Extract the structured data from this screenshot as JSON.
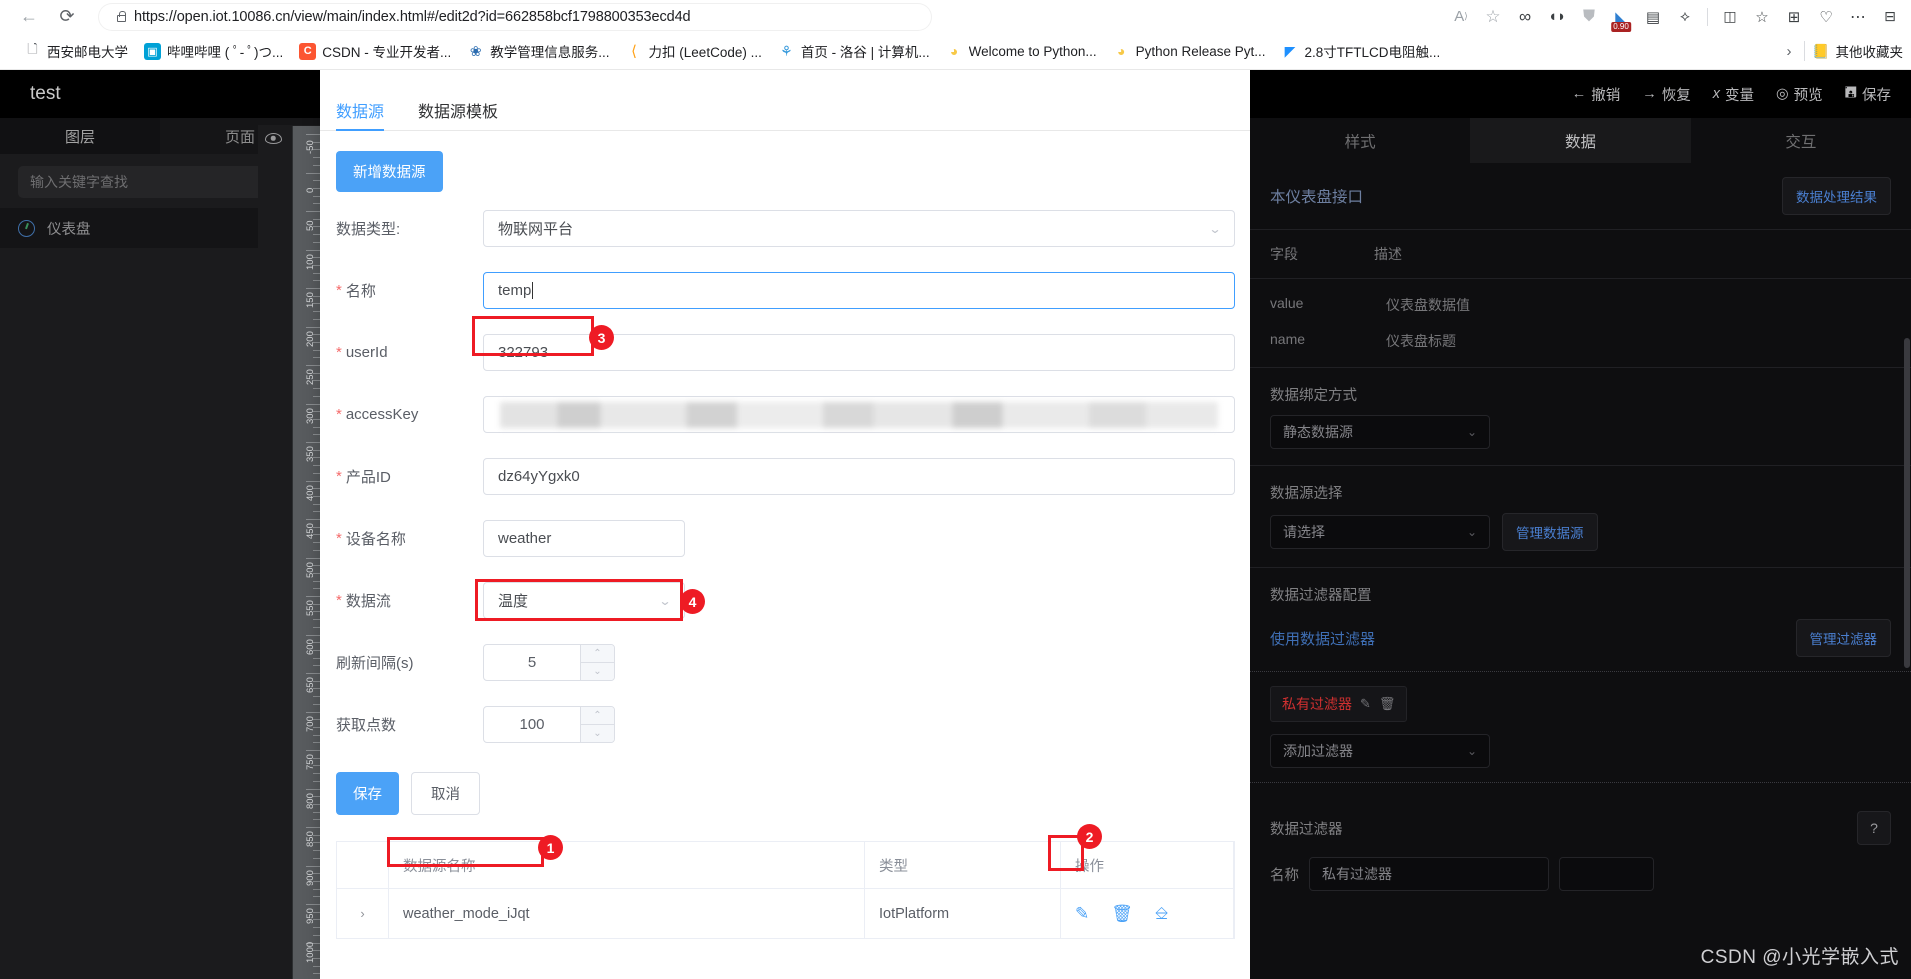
{
  "browser": {
    "url": "https://open.iot.10086.cn/view/main/index.html#/edit2d?id=662858bcf1798800353ecd4d",
    "back_label": "←",
    "reload_label": "⟳",
    "read_aloud_icon": "read-aloud-icon",
    "favorite_icon": "star-icon",
    "toolbar_icons": [
      {
        "name": "infinity-extension-icon",
        "glyph": "∞",
        "badge": ""
      },
      {
        "name": "split-dot-extension-icon",
        "glyph": "◖◗",
        "badge": ""
      },
      {
        "name": "shield-extension-icon",
        "glyph": "⛉",
        "badge": ""
      },
      {
        "name": "speed-extension-icon",
        "glyph": "◢",
        "badge": "0.90"
      },
      {
        "name": "collections-icon",
        "glyph": "▤",
        "badge": ""
      },
      {
        "name": "puzzle-extensions-icon",
        "glyph": "✧",
        "badge": ""
      },
      {
        "name": "split-screen-icon",
        "glyph": "▯▯",
        "badge": ""
      },
      {
        "name": "favorites-icon",
        "glyph": "☆",
        "badge": ""
      },
      {
        "name": "add-tab-group-icon",
        "glyph": "⊞",
        "badge": ""
      },
      {
        "name": "browser-essentials-icon",
        "glyph": "♡",
        "badge": ""
      },
      {
        "name": "settings-more-icon",
        "glyph": "⋯",
        "badge": ""
      },
      {
        "name": "sidebar-toggle-icon",
        "glyph": "⊡",
        "badge": ""
      }
    ],
    "bookmarks": [
      {
        "label": "西安邮电大学",
        "icon_glyph": "🗋",
        "icon_bg": "#ffffff",
        "icon_color": "#5f6368"
      },
      {
        "label": "哔哩哔哩 ( ﾟ- ﾟ)つ...",
        "icon_glyph": "📺",
        "icon_bg": "#00a1d6",
        "icon_color": "#ffffff"
      },
      {
        "label": "CSDN - 专业开发者...",
        "icon_glyph": "C",
        "icon_bg": "#fc5531",
        "icon_color": "#ffffff"
      },
      {
        "label": "教学管理信息服务...",
        "icon_glyph": "✿",
        "icon_bg": "#ffffff",
        "icon_color": "#2b6cb0"
      },
      {
        "label": "力扣 (LeetCode) ...",
        "icon_glyph": "⟨",
        "icon_bg": "#ffffff",
        "icon_color": "#ffa116"
      },
      {
        "label": "首页 - 洛谷 | 计算机...",
        "icon_glyph": "⚘",
        "icon_bg": "#ffffff",
        "icon_color": "#3498db"
      },
      {
        "label": "Welcome to Python...",
        "icon_glyph": "🐍",
        "icon_bg": "#ffffff",
        "icon_color": "#3776ab"
      },
      {
        "label": "Python Release Pyt...",
        "icon_glyph": "🐍",
        "icon_bg": "#ffffff",
        "icon_color": "#3776ab"
      },
      {
        "label": "2.8寸TFTLCD电阻触...",
        "icon_glyph": "◤",
        "icon_bg": "#ffffff",
        "icon_color": "#1e90ff"
      }
    ],
    "overflow_chevron": "›",
    "other_bookmarks": {
      "label": "其他收藏夹",
      "icon_glyph": "📙"
    }
  },
  "left_panel": {
    "title": "test",
    "tabs": [
      {
        "label": "图层",
        "active": true
      },
      {
        "label": "页面",
        "active": false
      }
    ],
    "search_placeholder": "输入关键字查找",
    "search_icon": "search-icon",
    "layers": [
      {
        "label": "仪表盘",
        "icon": "gauge-icon",
        "visibility_icon": "eye-icon"
      }
    ]
  },
  "ruler": {
    "eye_icon": "eye-icon",
    "ticks": [
      "-50",
      "0",
      "50",
      "100",
      "150",
      "200",
      "250",
      "300",
      "350",
      "400",
      "450",
      "500",
      "550",
      "600",
      "650",
      "700",
      "750",
      "800",
      "850",
      "900",
      "950",
      "1000"
    ]
  },
  "modal": {
    "tabs": [
      {
        "label": "数据源",
        "active": true
      },
      {
        "label": "数据源模板",
        "active": false
      }
    ],
    "add_button": "新增数据源",
    "fields": [
      {
        "label": "数据类型:",
        "required": false,
        "type": "select",
        "value": "物联网平台"
      },
      {
        "label": "名称",
        "required": true,
        "type": "text",
        "value": "temp"
      },
      {
        "label": "userId",
        "required": true,
        "type": "text",
        "value": "322793"
      },
      {
        "label": "accessKey",
        "required": true,
        "type": "masked",
        "value": ""
      },
      {
        "label": "产品ID",
        "required": true,
        "type": "text",
        "value": "dz64yYgxk0"
      },
      {
        "label": "设备名称",
        "required": true,
        "type": "text",
        "value": "weather"
      },
      {
        "label": "数据流",
        "required": true,
        "type": "select",
        "value": "温度"
      },
      {
        "label": "刷新间隔(s)",
        "required": false,
        "type": "number",
        "value": "5"
      },
      {
        "label": "获取点数",
        "required": false,
        "type": "number",
        "value": "100"
      }
    ],
    "save_button": "保存",
    "cancel_button": "取消",
    "table": {
      "columns": [
        "",
        "数据源名称",
        "类型",
        "操作"
      ],
      "rows": [
        {
          "expand_icon": "chevron-right-icon",
          "name": "weather_mode_iJqt",
          "type": "IotPlatform",
          "actions": [
            {
              "name": "edit-icon",
              "glyph": "✎"
            },
            {
              "name": "delete-icon",
              "glyph": "🗑"
            },
            {
              "name": "export-icon",
              "glyph": "⎘"
            }
          ]
        }
      ]
    }
  },
  "annotations": [
    {
      "number": "1",
      "target": "datasource-name-cell"
    },
    {
      "number": "2",
      "target": "edit-action-icon"
    },
    {
      "number": "3",
      "target": "name-input"
    },
    {
      "number": "4",
      "target": "datastream-select"
    }
  ],
  "right_panel": {
    "toolbar": [
      {
        "label": "撤销",
        "icon": "undo-arrow-icon",
        "glyph": "←"
      },
      {
        "label": "恢复",
        "icon": "redo-arrow-icon",
        "glyph": "→"
      },
      {
        "label": "变量",
        "icon": "variable-icon",
        "glyph": "x"
      },
      {
        "label": "预览",
        "icon": "preview-eye-icon",
        "glyph": "◎"
      },
      {
        "label": "保存",
        "icon": "save-disk-icon",
        "glyph": "🖫"
      }
    ],
    "tabs": [
      {
        "label": "样式",
        "active": false
      },
      {
        "label": "数据",
        "active": true
      },
      {
        "label": "交互",
        "active": false
      }
    ],
    "interface_title": "本仪表盘接口",
    "process_result_button": "数据处理结果",
    "field_columns": [
      "字段",
      "描述"
    ],
    "field_rows": [
      {
        "key": "value",
        "desc": "仪表盘数据值"
      },
      {
        "key": "name",
        "desc": "仪表盘标题"
      }
    ],
    "bind_mode_label": "数据绑定方式",
    "bind_mode_value": "静态数据源",
    "source_select_label": "数据源选择",
    "source_select_value": "请选择",
    "manage_source_button": "管理数据源",
    "filter_config_title": "数据过滤器配置",
    "use_filter_label": "使用数据过滤器",
    "manage_filter_button": "管理过滤器",
    "filter_chip_label": "私有过滤器",
    "filter_chip_edit_icon": "edit-icon",
    "filter_chip_delete_icon": "delete-icon",
    "add_filter_placeholder": "添加过滤器",
    "filter_section_title": "数据过滤器",
    "help_button": "?",
    "name_label": "名称",
    "name_value": "私有过滤器",
    "watermark": "CSDN @小光学嵌入式"
  }
}
